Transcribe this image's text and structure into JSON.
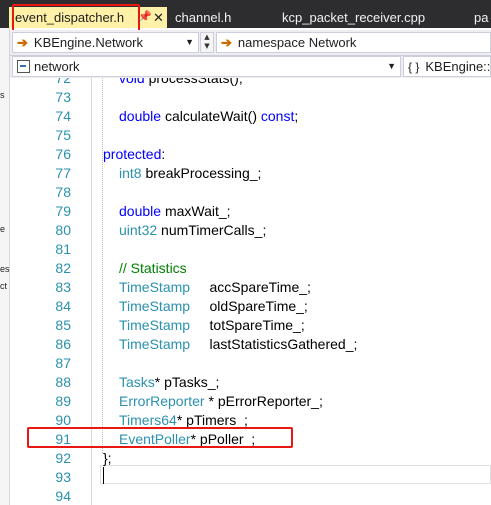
{
  "tabs": [
    {
      "label": "event_dispatcher.h",
      "active": true,
      "pin_icon": "pin-icon",
      "close_icon": "close-icon"
    },
    {
      "label": "channel.h"
    },
    {
      "label": "kcp_packet_receiver.cpp"
    },
    {
      "label": "pa"
    }
  ],
  "navbar": {
    "project_combo": "KBEngine.Network",
    "scope_combo": "namespace Network"
  },
  "navbar2": {
    "file_combo": "network",
    "member_combo": "KBEngine::N"
  },
  "left_strip_fragments": [
    "s",
    "e",
    "es",
    "ct"
  ],
  "editor": {
    "lines": [
      {
        "num": "72",
        "tokens": [
          {
            "t": "void ",
            "c": "kw"
          },
          {
            "t": "processStats();",
            "c": "id"
          }
        ],
        "indent": 1,
        "partial": true
      },
      {
        "num": "73",
        "tokens": [],
        "indent": 0
      },
      {
        "num": "74",
        "tokens": [
          {
            "t": "double ",
            "c": "kw"
          },
          {
            "t": "calculateWait() ",
            "c": "id"
          },
          {
            "t": "const",
            "c": "kw"
          },
          {
            "t": ";",
            "c": "id"
          }
        ],
        "indent": 1
      },
      {
        "num": "75",
        "tokens": [],
        "indent": 0
      },
      {
        "num": "76",
        "tokens": [
          {
            "t": "protected",
            "c": "kw"
          },
          {
            "t": ":",
            "c": "id"
          }
        ],
        "indent": 0
      },
      {
        "num": "77",
        "tokens": [
          {
            "t": "int8 ",
            "c": "ty"
          },
          {
            "t": "breakProcessing_;",
            "c": "id"
          }
        ],
        "indent": 1
      },
      {
        "num": "78",
        "tokens": [],
        "indent": 0
      },
      {
        "num": "79",
        "tokens": [
          {
            "t": "double ",
            "c": "kw"
          },
          {
            "t": "maxWait_;",
            "c": "id"
          }
        ],
        "indent": 1
      },
      {
        "num": "80",
        "tokens": [
          {
            "t": "uint32 ",
            "c": "ty"
          },
          {
            "t": "numTimerCalls_;",
            "c": "id"
          }
        ],
        "indent": 1
      },
      {
        "num": "81",
        "tokens": [],
        "indent": 0
      },
      {
        "num": "82",
        "tokens": [
          {
            "t": "// Statistics",
            "c": "cm"
          }
        ],
        "indent": 1
      },
      {
        "num": "83",
        "tokens": [
          {
            "t": "TimeStamp     ",
            "c": "ty"
          },
          {
            "t": "accSpareTime_;",
            "c": "id"
          }
        ],
        "indent": 1
      },
      {
        "num": "84",
        "tokens": [
          {
            "t": "TimeStamp     ",
            "c": "ty"
          },
          {
            "t": "oldSpareTime_;",
            "c": "id"
          }
        ],
        "indent": 1
      },
      {
        "num": "85",
        "tokens": [
          {
            "t": "TimeStamp     ",
            "c": "ty"
          },
          {
            "t": "totSpareTime_;",
            "c": "id"
          }
        ],
        "indent": 1
      },
      {
        "num": "86",
        "tokens": [
          {
            "t": "TimeStamp     ",
            "c": "ty"
          },
          {
            "t": "lastStatisticsGathered_;",
            "c": "id"
          }
        ],
        "indent": 1
      },
      {
        "num": "87",
        "tokens": [],
        "indent": 0
      },
      {
        "num": "88",
        "tokens": [
          {
            "t": "Tasks",
            "c": "ty"
          },
          {
            "t": "* pTasks_;",
            "c": "id"
          }
        ],
        "indent": 1
      },
      {
        "num": "89",
        "tokens": [
          {
            "t": "ErrorReporter",
            "c": "ty"
          },
          {
            "t": " * pErrorReporter_;",
            "c": "id"
          }
        ],
        "indent": 1
      },
      {
        "num": "90",
        "tokens": [
          {
            "t": "Timers64",
            "c": "ty"
          },
          {
            "t": "* pTimers_;",
            "c": "id"
          }
        ],
        "indent": 1
      },
      {
        "num": "91",
        "tokens": [
          {
            "t": "EventPoller",
            "c": "ty"
          },
          {
            "t": "* pPoller_;",
            "c": "id"
          }
        ],
        "indent": 1
      },
      {
        "num": "92",
        "tokens": [
          {
            "t": "};",
            "c": "id"
          }
        ],
        "indent": 0
      },
      {
        "num": "93",
        "tokens": [],
        "indent": 0
      },
      {
        "num": "94",
        "tokens": [],
        "indent": 0
      }
    ]
  },
  "colors": {
    "keyword": "#0000ff",
    "type": "#2b91af",
    "comment": "#008000",
    "line_number": "#2b91af",
    "active_tab": "#fff1a8",
    "highlight_box": "#e8170f"
  }
}
